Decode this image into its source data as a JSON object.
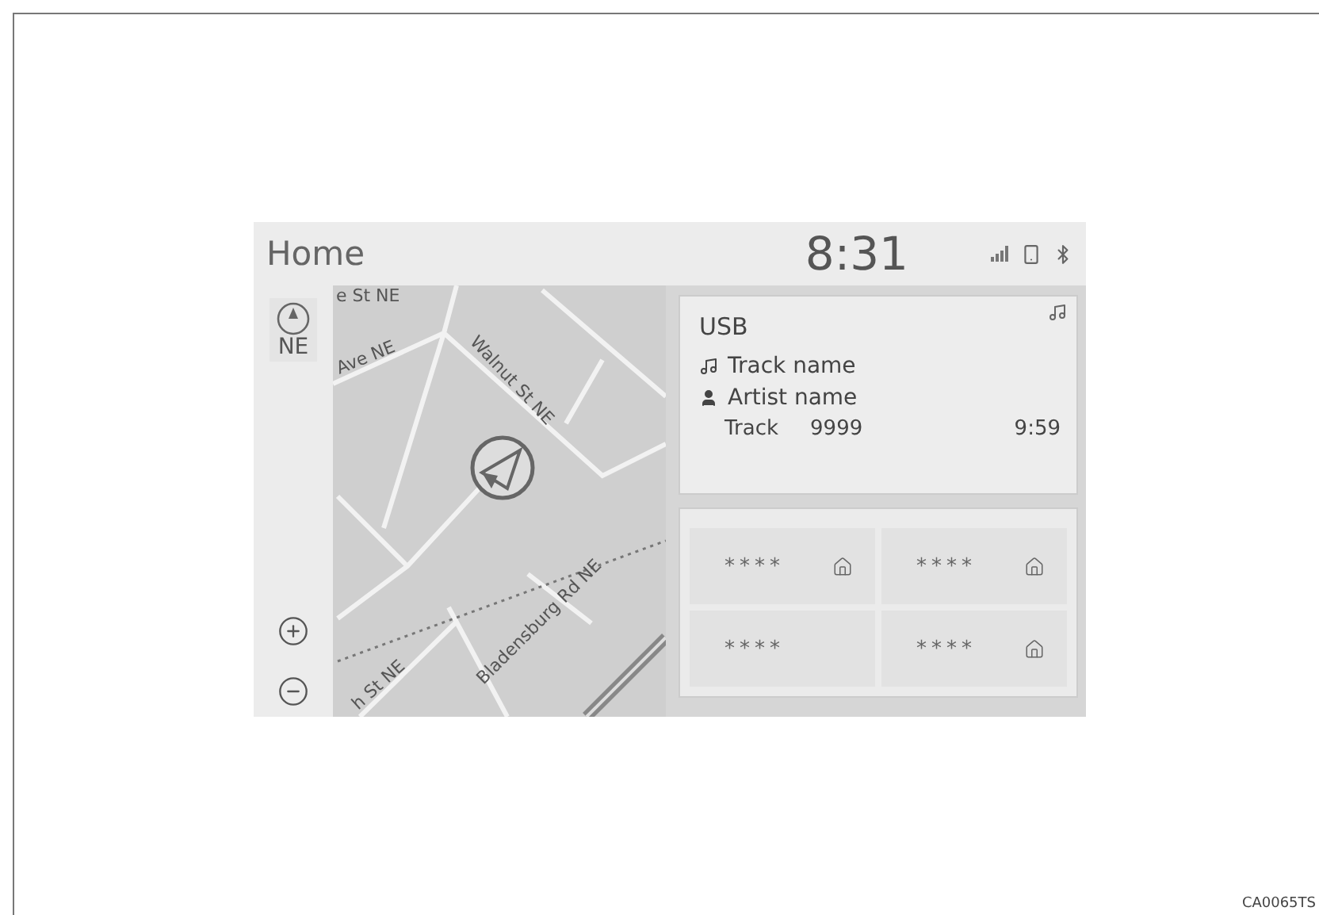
{
  "header": {
    "title": "Home",
    "time": "8:31"
  },
  "compass": {
    "heading": "NE"
  },
  "map": {
    "street_labels": [
      "e St NE",
      "Ave NE",
      "Walnut St NE",
      "Bladensburg Rd NE",
      "h St NE"
    ]
  },
  "audio": {
    "source": "USB",
    "track_name": "Track name",
    "artist_name": "Artist name",
    "track_label": "Track",
    "track_number": "9999",
    "time": "9:59"
  },
  "shortcuts": [
    {
      "label": "****",
      "kind": "home"
    },
    {
      "label": "****",
      "kind": "home"
    },
    {
      "label": "****",
      "kind": "plain"
    },
    {
      "label": "****",
      "kind": "home"
    }
  ],
  "figure_code": "CA0065TS"
}
